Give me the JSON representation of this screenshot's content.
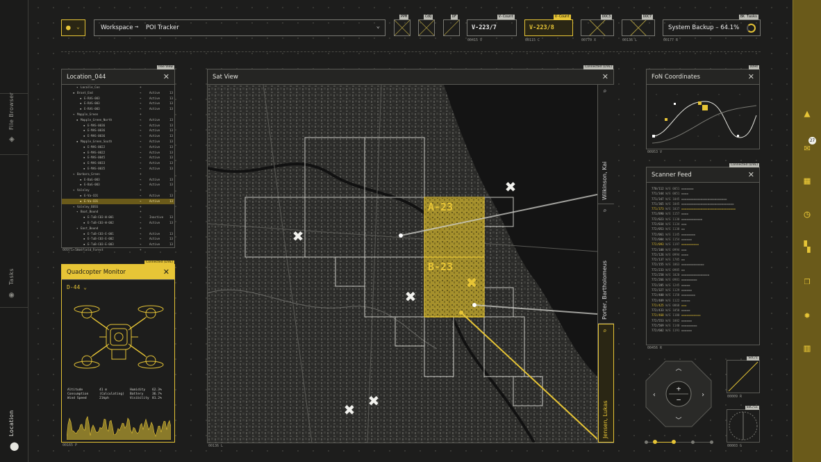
{
  "left_rail": {
    "file_browser": "File Browser",
    "tasks": "Tasks",
    "location": "Location"
  },
  "topbar": {
    "breadcrumb_root": "Workspace",
    "breadcrumb_arrow": "→",
    "breadcrumb_leaf": "POI Tracker",
    "small_boxes": [
      {
        "tag": "PPM"
      },
      {
        "tag": "CdQ"
      },
      {
        "tag": "DF"
      }
    ],
    "vcount1": {
      "tag": "V-Count",
      "value": "V-223/7",
      "sub": "00415 V"
    },
    "vcount2": {
      "tag": "V-Count",
      "value": "V-223/8",
      "sub": "00115 C"
    },
    "box3": {
      "tag": "DOC3",
      "sub": "00770 X"
    },
    "box4": {
      "tag": "DOC7",
      "sub": "00136 L"
    },
    "backup": {
      "tag": "BK Tasks",
      "value": "System Backup – 64.1%",
      "sub": "00177 R"
    }
  },
  "location_panel": {
    "title": "Location_044",
    "tag": "Tree View",
    "foot": "00971 S",
    "rows": [
      {
        "indent": 3,
        "label": "Lacalle_Cos",
        "status": "",
        "n": ""
      },
      {
        "indent": 2,
        "label": "Brant_End",
        "status": "Active",
        "n": "13"
      },
      {
        "indent": 4,
        "label": "E-RAS-003",
        "status": "Active",
        "n": "13"
      },
      {
        "indent": 4,
        "label": "E-RAS-003",
        "status": "Active",
        "n": "13"
      },
      {
        "indent": 4,
        "label": "E-RAS-003",
        "status": "Active",
        "n": "13"
      },
      {
        "indent": 2,
        "label": "Mapple_Green",
        "status": "",
        "n": ""
      },
      {
        "indent": 3,
        "label": "Mapple_Green_North",
        "status": "Active",
        "n": "13"
      },
      {
        "indent": 5,
        "label": "E-MAS-0036",
        "status": "Active",
        "n": "13"
      },
      {
        "indent": 5,
        "label": "E-MAS-0036",
        "status": "Active",
        "n": "13"
      },
      {
        "indent": 5,
        "label": "E-MAS-0036",
        "status": "Active",
        "n": "13"
      },
      {
        "indent": 3,
        "label": "Mapple_Green_South",
        "status": "Active",
        "n": "13"
      },
      {
        "indent": 5,
        "label": "E-MAS-0022",
        "status": "Active",
        "n": "13"
      },
      {
        "indent": 5,
        "label": "E-MAS-0022",
        "status": "Active",
        "n": "13"
      },
      {
        "indent": 5,
        "label": "E-MAS-0045",
        "status": "Active",
        "n": "13"
      },
      {
        "indent": 5,
        "label": "E-MAS-0033",
        "status": "Active",
        "n": "13"
      },
      {
        "indent": 5,
        "label": "E-MAS-0035",
        "status": "Active",
        "n": "13"
      },
      {
        "indent": 2,
        "label": "Barbara_Green",
        "status": "",
        "n": ""
      },
      {
        "indent": 4,
        "label": "E-BaG-003",
        "status": "Active",
        "n": "13"
      },
      {
        "indent": 4,
        "label": "E-BaG-003",
        "status": "Active",
        "n": "13"
      },
      {
        "indent": 2,
        "label": "Valeley",
        "status": "",
        "n": ""
      },
      {
        "indent": 4,
        "label": "E-Va-CO1",
        "status": "Active",
        "n": "13"
      },
      {
        "indent": 4,
        "label": "E-Va-CO1",
        "status": "Active",
        "n": "13",
        "sel": true
      },
      {
        "indent": 2,
        "label": "Valeley_BUSS",
        "status": "",
        "n": ""
      },
      {
        "indent": 3,
        "label": "Boat_Bound",
        "status": "",
        "n": ""
      },
      {
        "indent": 5,
        "label": "E-TuB-C03-W-001",
        "status": "Inactive",
        "n": "13"
      },
      {
        "indent": 5,
        "label": "E-TuB-C03-W-002",
        "status": "Active",
        "n": "13"
      },
      {
        "indent": 3,
        "label": "East_Bound",
        "status": "",
        "n": ""
      },
      {
        "indent": 5,
        "label": "E-TuB-C03-E-001",
        "status": "Active",
        "n": "13"
      },
      {
        "indent": 5,
        "label": "E-TuB-C03-E-002",
        "status": "Active",
        "n": "13"
      },
      {
        "indent": 5,
        "label": "E-TuB-C03-E-003",
        "status": "Active",
        "n": "13"
      },
      {
        "indent": 2,
        "label": "Hatfield_Forest",
        "status": "",
        "n": ""
      }
    ]
  },
  "quad_panel": {
    "title": "Quadcopter Monitor",
    "tag": "Connected (LIVE)",
    "drone_id": "D-44",
    "foot": "00165 P",
    "stats": [
      [
        "Altitude",
        "41 m",
        "Humidity",
        "62.3%"
      ],
      [
        "Consumption",
        "(Calculating)",
        "Battery",
        "36.7%"
      ],
      [
        "Wind Speed",
        "21kph",
        "Visibility",
        "81.2%"
      ]
    ]
  },
  "sat_panel": {
    "title": "Sat View",
    "tag": "Connected (LIVE)",
    "foot": "00136 L",
    "zone_a": "A-23",
    "zone_b": "B-23",
    "contacts": [
      "Wilkinson, Kai",
      "Porter, Bartholomeus",
      "Jensen, Lukas"
    ]
  },
  "fon_panel": {
    "title": "FoN Coordinates",
    "tag": "0094",
    "foot": "00953 V"
  },
  "scanner_panel": {
    "title": "Scanner Feed",
    "tag": "Connected (LIVE)",
    "foot": "00456 R",
    "rows": [
      {
        "id": "770/112",
        "code": "W/E 0051",
        "bars": "=======",
        "hl": false
      },
      {
        "id": "771/344",
        "code": "W/E 0051",
        "bars": "====",
        "hl": false
      },
      {
        "id": "771/347",
        "code": "W/E 1045",
        "bars": "==========================",
        "hl": false
      },
      {
        "id": "771/365",
        "code": "W/E 1045",
        "bars": "==============================",
        "hl": false
      },
      {
        "id": "771/373",
        "code": "W/E 1037",
        "bars": "===============================",
        "hl": true
      },
      {
        "id": "771/890",
        "code": "W/E 1157",
        "bars": "====",
        "hl": false
      },
      {
        "id": "772/023",
        "code": "W/E 1130",
        "bars": "============",
        "hl": false
      },
      {
        "id": "772/034",
        "code": "W/E 1134",
        "bars": "===",
        "hl": false
      },
      {
        "id": "772/053",
        "code": "W/E 1138",
        "bars": "==",
        "hl": false
      },
      {
        "id": "772/061",
        "code": "W/E 1145",
        "bars": "========",
        "hl": false
      },
      {
        "id": "772/084",
        "code": "W/E 1154",
        "bars": "======",
        "hl": false
      },
      {
        "id": "772/093",
        "code": "W/E 1197",
        "bars": "==========",
        "hl": true
      },
      {
        "id": "772/108",
        "code": "W/E 0994",
        "bars": "===",
        "hl": false
      },
      {
        "id": "772/126",
        "code": "W/E 0994",
        "bars": "====",
        "hl": false
      },
      {
        "id": "772/137",
        "code": "W/E 1785",
        "bars": "==",
        "hl": false
      },
      {
        "id": "772/155",
        "code": "W/E 1063",
        "bars": "=============",
        "hl": false
      },
      {
        "id": "772/233",
        "code": "W/E 0985",
        "bars": "==",
        "hl": false
      },
      {
        "id": "772/258",
        "code": "W/E 1020",
        "bars": "================",
        "hl": false
      },
      {
        "id": "772/266",
        "code": "W/E 0981",
        "bars": "=========",
        "hl": false
      },
      {
        "id": "772/285",
        "code": "W/E 1245",
        "bars": "=====",
        "hl": false
      },
      {
        "id": "772/327",
        "code": "W/E 1129",
        "bars": "======",
        "hl": false
      },
      {
        "id": "772/400",
        "code": "W/E 1158",
        "bars": "========",
        "hl": false
      },
      {
        "id": "772/409",
        "code": "W/E 1122",
        "bars": "=====",
        "hl": false
      },
      {
        "id": "772/425",
        "code": "W/E 0868",
        "bars": "===",
        "hl": true
      },
      {
        "id": "772/433",
        "code": "W/E 1058",
        "bars": "=====",
        "hl": false
      },
      {
        "id": "772/468",
        "code": "W/E 1100",
        "bars": "===========",
        "hl": true
      },
      {
        "id": "772/553",
        "code": "W/E 1082",
        "bars": "======",
        "hl": false
      },
      {
        "id": "772/569",
        "code": "W/E 1140",
        "bars": "=========",
        "hl": false
      },
      {
        "id": "772/602",
        "code": "W/E 1191",
        "bars": "======",
        "hl": false
      }
    ]
  },
  "minis": [
    {
      "tag": "SoC/I",
      "foot": "00009 R"
    },
    {
      "tag": "SoC/II",
      "foot": "00003 G"
    }
  ],
  "right_rail": {
    "badge_count": "27"
  },
  "colors": {
    "accent": "#e7c536",
    "background": "#1d1d1c",
    "rail": "#6a5a1a"
  }
}
